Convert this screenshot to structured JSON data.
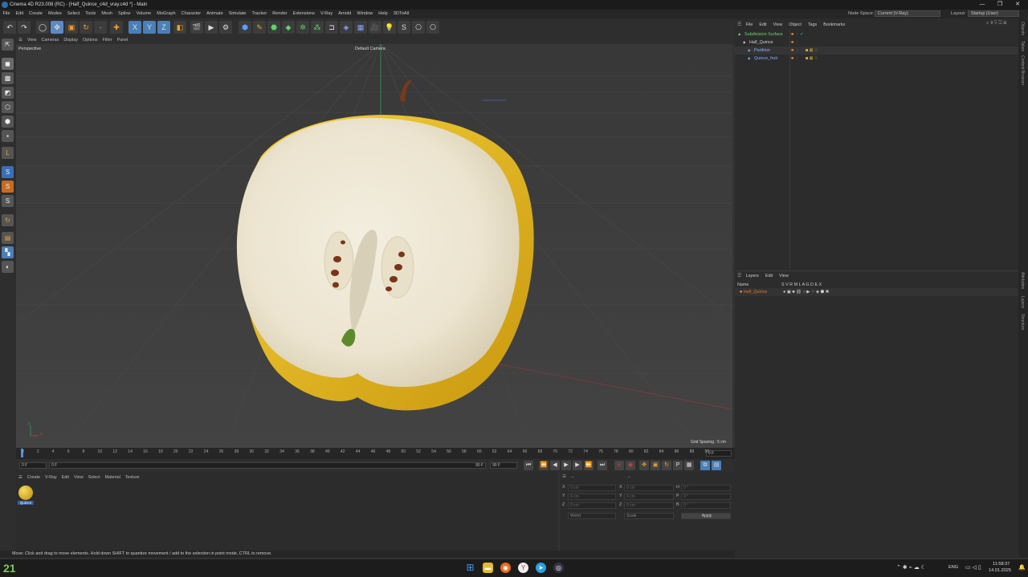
{
  "window": {
    "title": "Cinema 4D R23.008 (RC) - [Half_Quince_c4d_vray.c4d *] - Main",
    "minimize": "—",
    "maximize": "❐",
    "close": "✕"
  },
  "menu": [
    "File",
    "Edit",
    "Create",
    "Modes",
    "Select",
    "Tools",
    "Mesh",
    "Spline",
    "Volume",
    "MoGraph",
    "Character",
    "Animate",
    "Simulate",
    "Tracker",
    "Render",
    "Extensions",
    "V-Ray",
    "Arnold",
    "Window",
    "Help",
    "3DToAll"
  ],
  "node_space": {
    "label": "Node Space:",
    "value": "Current (V-Ray)"
  },
  "layout": {
    "label": "Layout:",
    "value": "Startup (User)"
  },
  "toolbar": {
    "x": "X",
    "y": "Y",
    "z": "Z"
  },
  "viewport": {
    "menu": [
      "View",
      "Cameras",
      "Display",
      "Options",
      "Filter",
      "Panel"
    ],
    "label": "Perspective",
    "camera": "Default Camera",
    "grid_spacing": "Grid Spacing : 5 cm",
    "axis_x": "x",
    "axis_y": "y",
    "accent_fruit_yellow": "#f0c21a",
    "accent_flesh": "#efe8d2"
  },
  "timeline": {
    "ticks": [
      "0",
      "2",
      "4",
      "6",
      "8",
      "10",
      "12",
      "14",
      "16",
      "18",
      "20",
      "22",
      "24",
      "26",
      "28",
      "30",
      "32",
      "34",
      "36",
      "38",
      "40",
      "42",
      "44",
      "46",
      "48",
      "50",
      "52",
      "54",
      "56",
      "58",
      "60",
      "62",
      "64",
      "66",
      "68",
      "70",
      "72",
      "74",
      "76",
      "78",
      "80",
      "82",
      "84",
      "86",
      "88",
      "90"
    ],
    "current": "0 F"
  },
  "transport": {
    "start": "0 F",
    "min": "0 F",
    "max": "90 F",
    "end": "90 F"
  },
  "material_manager": {
    "menu": [
      "Create",
      "V-Ray",
      "Edit",
      "View",
      "Select",
      "Material",
      "Texture"
    ],
    "material_name": "Quince"
  },
  "coordinates": {
    "dash1": "--",
    "dash2": "--",
    "rows": [
      {
        "a": "X",
        "av": "0 cm",
        "b": "X",
        "bv": "0 cm",
        "c": "H",
        "cv": "0 °"
      },
      {
        "a": "Y",
        "av": "0 cm",
        "b": "Y",
        "bv": "0 cm",
        "c": "P",
        "cv": "0 °"
      },
      {
        "a": "Z",
        "av": "0 cm",
        "b": "Z",
        "bv": "0 cm",
        "c": "B",
        "cv": "0 °"
      }
    ],
    "mode": "World",
    "scale": "Scale",
    "apply": "Apply"
  },
  "status_text": "Move: Click and drag to move elements. Hold down SHIFT to quantize movement / add to the selection in point mode, CTRL to remove.",
  "object_manager": {
    "menu": [
      "File",
      "Edit",
      "View",
      "Object",
      "Tags",
      "Bookmarks"
    ],
    "objects": [
      {
        "name": "Subdivision Surface",
        "color": "#6cd36c"
      },
      {
        "name": "Half_Quince",
        "color": "#cfcfcf"
      },
      {
        "name": "Partition",
        "color": "#8ab0ff"
      },
      {
        "name": "Quince_fruit",
        "color": "#8ab0ff"
      }
    ]
  },
  "layer_manager": {
    "menu": [
      "Layers",
      "Edit",
      "View"
    ],
    "header_name": "Name",
    "header_flags": "S V R M L A G D E X",
    "layer_name": "Half_Quince"
  },
  "side_tabs": [
    "Objects",
    "Takes",
    "Content Browser",
    "Attributes",
    "Layers",
    "Structure"
  ],
  "taskbar": {
    "weather": "21",
    "lang": "ENG",
    "time": "11:58:37",
    "date": "14.01.2025"
  }
}
